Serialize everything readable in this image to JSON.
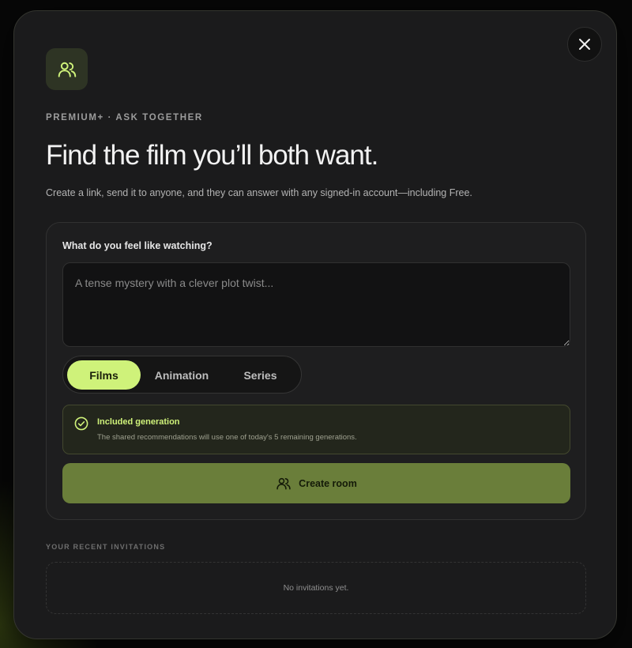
{
  "colors": {
    "accent": "#cff27a",
    "button": "#6a7e3a",
    "surface": "#1b1b1c"
  },
  "modal": {
    "close_icon": "close-icon",
    "hero_icon": "users-icon",
    "eyebrow": "PREMIUM+ · ASK TOGETHER",
    "title": "Find the film you’ll both want.",
    "subtitle": "Create a link, send it to anyone, and they can answer with any signed-in account—including Free."
  },
  "form": {
    "label": "What do you feel like watching?",
    "prompt_placeholder": "A tense mystery with a clever plot twist...",
    "prompt_value": "",
    "media_types": [
      {
        "label": "Films",
        "selected": true
      },
      {
        "label": "Animation",
        "selected": false
      },
      {
        "label": "Series",
        "selected": false
      }
    ],
    "notice": {
      "icon": "check-circle-icon",
      "title": "Included generation",
      "text": "The shared recommendations will use one of today's 5 remaining generations."
    },
    "create_button": {
      "icon": "users-icon",
      "label": "Create room"
    }
  },
  "invitations": {
    "heading": "YOUR RECENT INVITATIONS",
    "empty_text": "No invitations yet."
  }
}
